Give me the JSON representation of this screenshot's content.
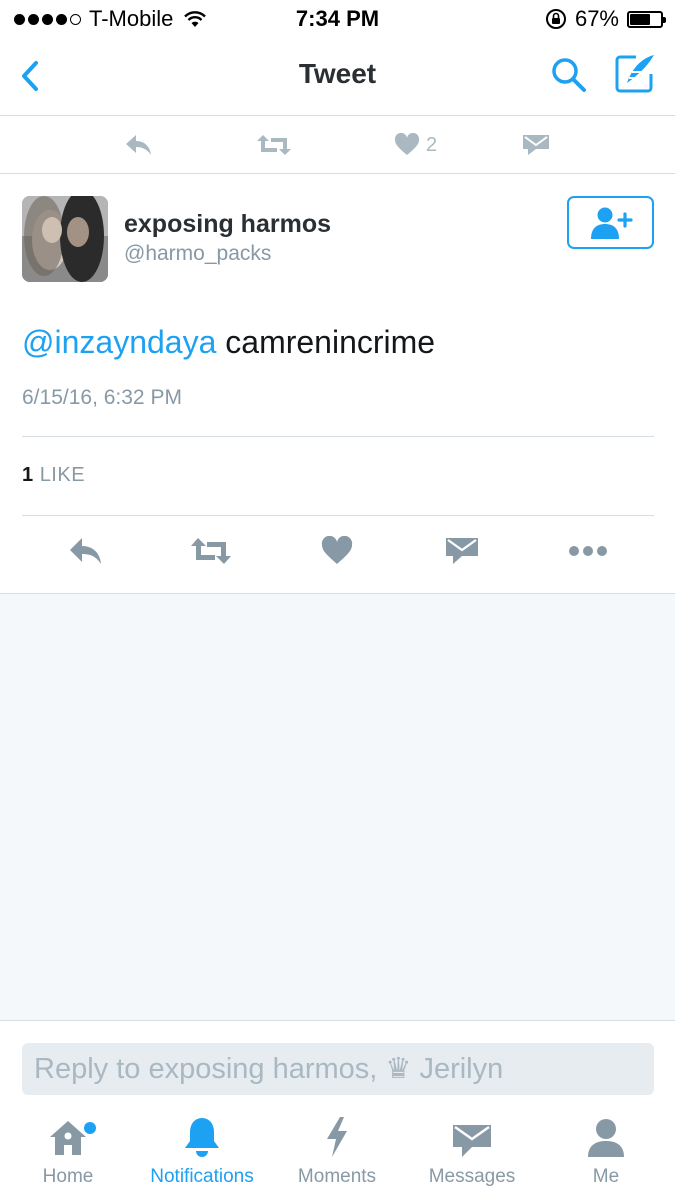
{
  "status_bar": {
    "carrier": "T-Mobile",
    "time": "7:34 PM",
    "battery_percent": "67%",
    "battery_level": 0.67
  },
  "nav": {
    "title": "Tweet",
    "icons": [
      "back-chevron-icon",
      "search-icon",
      "compose-tweet-icon"
    ],
    "accent_color": "#1da1f2"
  },
  "parent_actions": {
    "like_count": "2"
  },
  "tweet": {
    "author_name": "exposing harmos",
    "author_handle": "@harmo_packs",
    "mention": "@inzayndaya",
    "text": " camrenincrime",
    "timestamp": "6/15/16, 6:32 PM",
    "like_count": "1",
    "like_label": "LIKE"
  },
  "reply": {
    "placeholder": "Reply to exposing harmos, ♛ Jerilyn"
  },
  "tabs": [
    {
      "label": "Home",
      "icon": "home-icon",
      "active": false,
      "has_badge": true
    },
    {
      "label": "Notifications",
      "icon": "bell-icon",
      "active": true
    },
    {
      "label": "Moments",
      "icon": "lightning-icon",
      "active": false
    },
    {
      "label": "Messages",
      "icon": "envelope-icon",
      "active": false
    },
    {
      "label": "Me",
      "icon": "person-icon",
      "active": false
    }
  ]
}
